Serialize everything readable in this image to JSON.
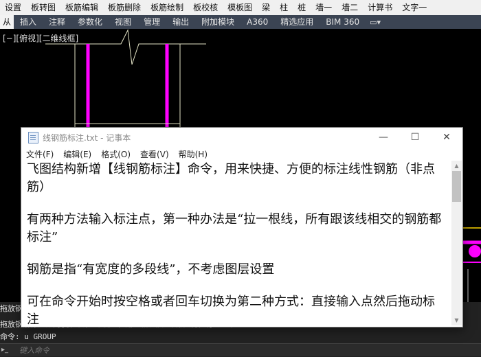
{
  "menubar": {
    "items": [
      "设置",
      "板转图",
      "板筋编辑",
      "板筋删除",
      "板筋绘制",
      "板校核",
      "模板图",
      "梁",
      "柱",
      "桩",
      "墙一",
      "墙二",
      "计算书",
      "文字一"
    ]
  },
  "ribbon": {
    "active_tab": "从",
    "tabs": [
      "插入",
      "注释",
      "参数化",
      "视图",
      "管理",
      "输出",
      "附加模块",
      "A360",
      "精选应用",
      "BIM 360"
    ],
    "extra_button": "▭▾"
  },
  "canvas": {
    "view_label": "[−][俯视][二维线框]"
  },
  "colors": {
    "rebar": "#ff00ff",
    "outline": "#e6e6c8",
    "yellow": "#ffd700",
    "cad_bg": "#000000"
  },
  "notepad": {
    "title": "线钢筋标注.txt - 记事本",
    "controls": {
      "minimize": "—",
      "maximize": "☐",
      "close": "✕"
    },
    "menus": [
      "文件(F)",
      "编辑(E)",
      "格式(O)",
      "查看(V)",
      "帮助(H)"
    ],
    "lines": [
      "飞图结构新增【线钢筋标注】命令，用来快捷、方便的标注线性钢筋（非点筋）",
      "有两种方法输入标注点，第一种办法是“拉一根线，所有跟该线相交的钢筋都标注”",
      "钢筋是指“有宽度的多段线”，不考虑图层设置",
      "可在命令开始时按空格或者回车切换为第二种方式：直接输入点然后拖动标注"
    ]
  },
  "command": {
    "history": [
      "拖放钢",
      "拖放钢筋标注方向[引出线在单侧时，用空格切换是否折线引出]<退出>:",
      "命令: u GROUP"
    ],
    "input_placeholder": "键入命令",
    "input_icon": "▸_"
  }
}
